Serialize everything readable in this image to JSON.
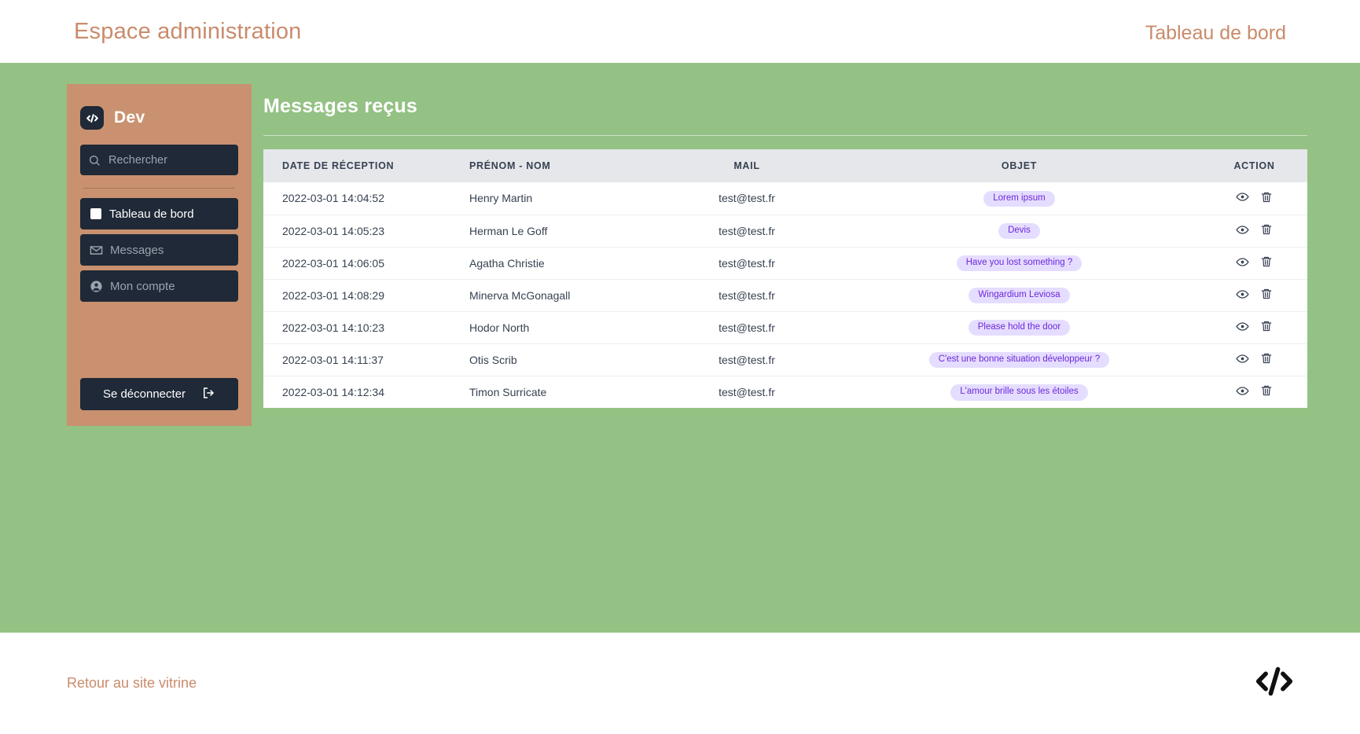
{
  "header": {
    "brand_title": "Espace administration",
    "page_label": "Tableau de bord"
  },
  "sidebar": {
    "logo_icon": "code-icon",
    "brand_name": "Dev",
    "search": {
      "icon": "search-icon",
      "placeholder": "Rechercher",
      "value": ""
    },
    "items": [
      {
        "label": "Tableau de bord",
        "icon": "chart-bar-icon",
        "active": true
      },
      {
        "label": "Messages",
        "icon": "envelope-icon",
        "active": false
      },
      {
        "label": "Mon compte",
        "icon": "user-circle-icon",
        "active": false
      }
    ],
    "logout": {
      "label": "Se déconnecter",
      "icon": "sign-out-icon"
    }
  },
  "main": {
    "title": "Messages reçus",
    "table": {
      "columns": [
        "DATE DE RÉCEPTION",
        "PRÉNOM - NOM",
        "MAIL",
        "OBJET",
        "ACTION"
      ],
      "rows": [
        {
          "date": "2022-03-01 14:04:52",
          "name": "Henry Martin",
          "mail": "test@test.fr",
          "objet": "Lorem ipsum",
          "actions": [
            "eye-icon",
            "trash-icon"
          ]
        },
        {
          "date": "2022-03-01 14:05:23",
          "name": "Herman Le Goff",
          "mail": "test@test.fr",
          "objet": "Devis",
          "actions": [
            "eye-icon",
            "trash-icon"
          ]
        },
        {
          "date": "2022-03-01 14:06:05",
          "name": "Agatha Christie",
          "mail": "test@test.fr",
          "objet": "Have you lost something ?",
          "actions": [
            "eye-icon",
            "trash-icon"
          ]
        },
        {
          "date": "2022-03-01 14:08:29",
          "name": "Minerva McGonagall",
          "mail": "test@test.fr",
          "objet": "Wingardium Leviosa",
          "actions": [
            "eye-icon",
            "trash-icon"
          ]
        },
        {
          "date": "2022-03-01 14:10:23",
          "name": "Hodor North",
          "mail": "test@test.fr",
          "objet": "Please hold the door",
          "actions": [
            "eye-icon",
            "trash-icon"
          ]
        },
        {
          "date": "2022-03-01 14:11:37",
          "name": "Otis Scrib",
          "mail": "test@test.fr",
          "objet": "C'est une bonne situation développeur ?",
          "actions": [
            "eye-icon",
            "trash-icon"
          ]
        },
        {
          "date": "2022-03-01 14:12:34",
          "name": "Timon Surricate",
          "mail": "test@test.fr",
          "objet": "L'amour brille sous les étoiles",
          "actions": [
            "eye-icon",
            "trash-icon"
          ]
        }
      ]
    }
  },
  "footer": {
    "link_label": "Retour au site vitrine",
    "logo_icon": "code-icon"
  },
  "colors": {
    "accent": "#c98b6b",
    "green_bg": "#94c184",
    "sidebar_bg": "#c9916f",
    "dark": "#1f2937",
    "tag_bg": "#e5ddff",
    "tag_text": "#6d28d9",
    "table_head_bg": "#e5e7eb"
  }
}
